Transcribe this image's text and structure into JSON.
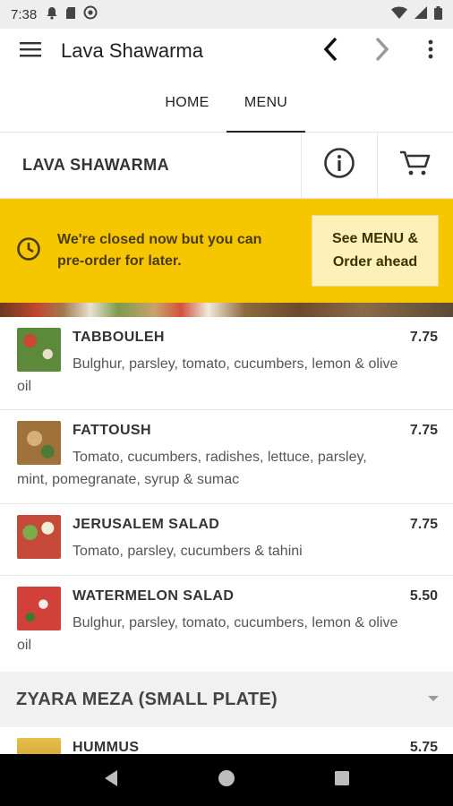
{
  "status_bar": {
    "time": "7:38",
    "left_icons": [
      "notification-bell-icon",
      "sd-card-icon",
      "sync-icon"
    ],
    "right_icons": [
      "wifi-icon",
      "cellular-icon",
      "battery-icon"
    ]
  },
  "app_bar": {
    "title": "Lava Shawarma",
    "icons": [
      "hamburger-menu-icon",
      "back-chevron-icon",
      "forward-chevron-icon",
      "overflow-menu-icon"
    ]
  },
  "tabs": [
    {
      "label": "HOME",
      "active": false
    },
    {
      "label": "MENU",
      "active": true
    }
  ],
  "restaurant": {
    "name": "LAVA SHAWARMA",
    "icons": [
      "info-icon",
      "cart-icon"
    ]
  },
  "banner": {
    "message_line1": "We're closed now but you can",
    "message_line2": "pre-order for later.",
    "button_line1": "See MENU &",
    "button_line2": "Order ahead",
    "color": "#f6c700"
  },
  "menu_items": [
    {
      "name": "TABBOULEH",
      "price": "7.75",
      "description": "Bulghur, parsley, tomato, cucumbers, lemon & olive oil",
      "thumb_color": "#5d8a3a"
    },
    {
      "name": "FATTOUSH",
      "price": "7.75",
      "description": "Tomato, cucumbers, radishes, lettuce, parsley, mint, pomegranate, syrup & sumac",
      "thumb_color": "#a0713a"
    },
    {
      "name": "JERUSALEM SALAD",
      "price": "7.75",
      "description": "Tomato, parsley, cucumbers & tahini",
      "thumb_color": "#c64a3a"
    },
    {
      "name": "WATERMELON SALAD",
      "price": "5.50",
      "description": "Bulghur, parsley, tomato, cucumbers, lemon & olive oil",
      "thumb_color": "#d2403a"
    }
  ],
  "section": {
    "title": "ZYARA MEZA (SMALL PLATE)"
  },
  "next_item": {
    "name": "HUMMUS",
    "price": "5.75"
  },
  "nav_bar": {
    "icons": [
      "back-triangle-icon",
      "home-circle-icon",
      "recents-square-icon"
    ]
  }
}
